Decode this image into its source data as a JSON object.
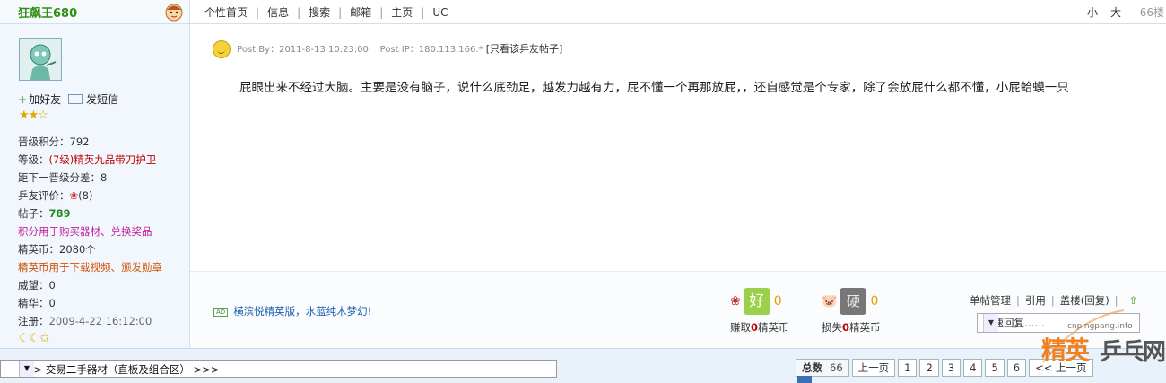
{
  "user": {
    "name": "狂飙王680",
    "add_friend": "加好友",
    "send_message": "发短信",
    "stars": "★★☆",
    "stats": {
      "points_label": "晋级积分：",
      "points_value": "792",
      "level_label": "等级：",
      "level_value": "(7级)精英九品带刀护卫",
      "next_label": "距下一晋级分差：",
      "next_value": "8",
      "rating_label": "乒友评价：",
      "rating_value": "(8)",
      "posts_label": "帖子：",
      "posts_value": "789",
      "points_note": "积分用于购买器材、兑换奖品",
      "coins_label": "精英币：",
      "coins_value": "2080个",
      "coins_note": "精英币用于下载视频、颁发勋章",
      "prestige_label": "威望：",
      "prestige_value": "0",
      "essence_label": "精华：",
      "essence_value": "0",
      "register_label": "注册：",
      "register_value": "2009-4-22 16:12:00"
    },
    "moons": "☾☾✩"
  },
  "nav": {
    "items": [
      "个性首页",
      "信息",
      "搜索",
      "邮箱",
      "主页",
      "UC"
    ],
    "font_small": "小",
    "font_large": "大",
    "floor": "66楼"
  },
  "post": {
    "post_by_label": "Post By：",
    "post_time": "2011-8-13 10:23:00",
    "post_ip_label": "Post IP：",
    "post_ip": "180.113.166.*",
    "only_author": "[只看该乒友帖子]",
    "content": "屁眼出来不经过大脑。主要是没有脑子，说什么底劲足，越发力越有力，屁不懂一个再那放屁，，还自感觉是个专家，除了会放屁什么都不懂，小屁蛤蟆一只"
  },
  "footer": {
    "ad_tag": "AD",
    "ad_text": "横滨悦精英版，水蓝纯木梦幻!",
    "good_icon": "好",
    "good_count": "0",
    "earn_pre": "赚取",
    "earn_zero": "0",
    "earn_post": "精英币",
    "bad_icon": "硬",
    "bad_count": "0",
    "lose_pre": "损失",
    "lose_zero": "0",
    "lose_post": "精英币",
    "tools": [
      "单帖管理",
      "引用",
      "盖楼(回复)"
    ],
    "quick_reply": "快速回复……"
  },
  "bottom": {
    "forum_jump": "├>> 交易二手器材（直板及组合区） >>>",
    "total_label": "总数",
    "total_value": "66",
    "prev_page": "上一页",
    "pages": [
      "1",
      "2",
      "3",
      "4",
      "5",
      "6"
    ],
    "next_more": "<< 上一页"
  },
  "watermark": {
    "url": "cnpingpang.info",
    "logo_left": "精英",
    "logo_right": "乒乓网"
  }
}
